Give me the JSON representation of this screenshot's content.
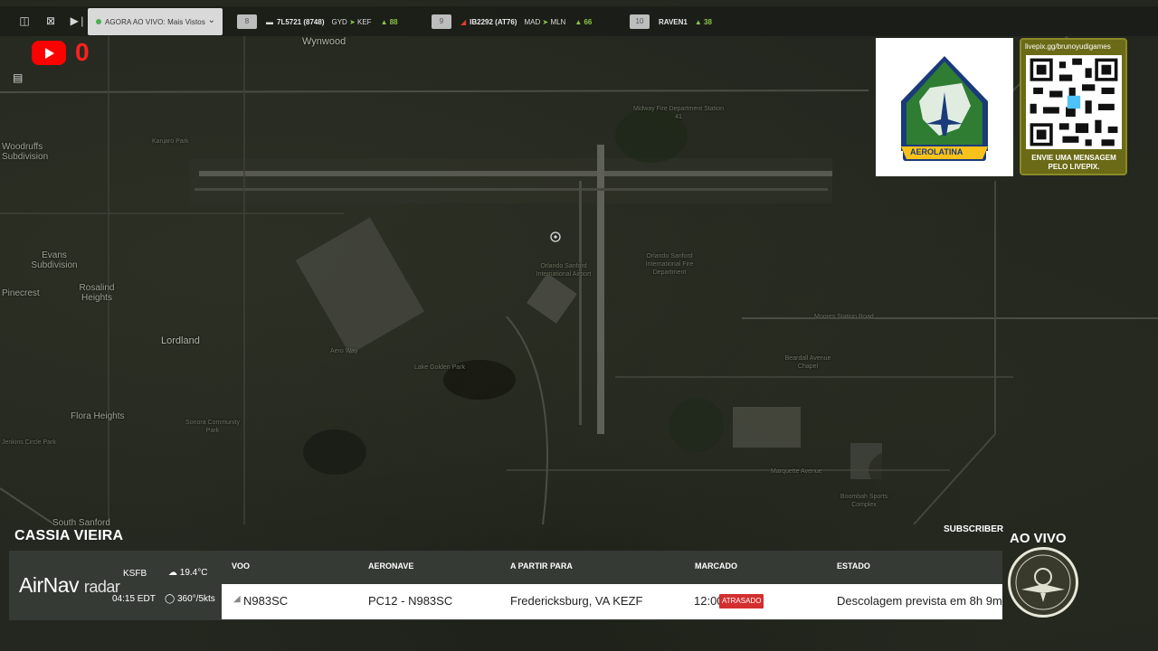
{
  "topbar": {
    "live_label": "AGORA AO VIVO: Mais Vistos",
    "flights": [
      {
        "num": "8",
        "code": "7L5721 (8748)",
        "from": "GYD",
        "to": "KEF",
        "count": "88"
      },
      {
        "num": "9",
        "code": "IB2292 (AT76)",
        "from": "MAD",
        "to": "MLN",
        "count": "66"
      },
      {
        "num": "10",
        "code": "RAVEN1",
        "from": "",
        "to": "",
        "count": "38"
      }
    ]
  },
  "youtube": {
    "count": "0"
  },
  "map": {
    "labels": [
      "Wynwood",
      "Woodruffs Subdivision",
      "Evans Subdivision",
      "Pinecrest",
      "Rosalind Heights",
      "Lordland",
      "Flora Heights",
      "South Sanford",
      "Orlando Sanford International Airport",
      "Orlando Sanford International Fire Department",
      "Midway Fire Department Station 41",
      "Lake Golden Park",
      "Beardall Avenue Chapel",
      "Boombah Sports Complex",
      "Jenkins Circle Park",
      "Sonora Community Park",
      "Kanjaro Park",
      "Marquette Avenue",
      "Moores Station Road",
      "Aero Way"
    ]
  },
  "logos": {
    "aero_name": "AEROLATINA",
    "qr_url": "livepix.gg/brunoyudigames",
    "qr_message": "ENVIE UMA MENSAGEM PELO LIVEPIX."
  },
  "panel": {
    "pilot": "CASSIA VIEIRA",
    "subscriber_label": "SUBSCRIBER",
    "brand": "AirNav",
    "brand_sub": "radar",
    "airport": "KSFB",
    "time": "04:15 EDT",
    "temp": "19.4°C",
    "wind": "360°/5kts",
    "headers": {
      "voo": "VOO",
      "aeronave": "AERONAVE",
      "route": "A PARTIR PARA",
      "scheduled": "MARCADO",
      "status": "ESTADO"
    },
    "row": {
      "voo": "N983SC",
      "aeronave": "PC12 - N983SC",
      "route": "Fredericksburg, VA KEZF",
      "scheduled": "12:00",
      "delay": "ATRASADO",
      "status": "Descolagem prevista em 8h 9m"
    },
    "ao_vivo": "AO VIVO"
  }
}
